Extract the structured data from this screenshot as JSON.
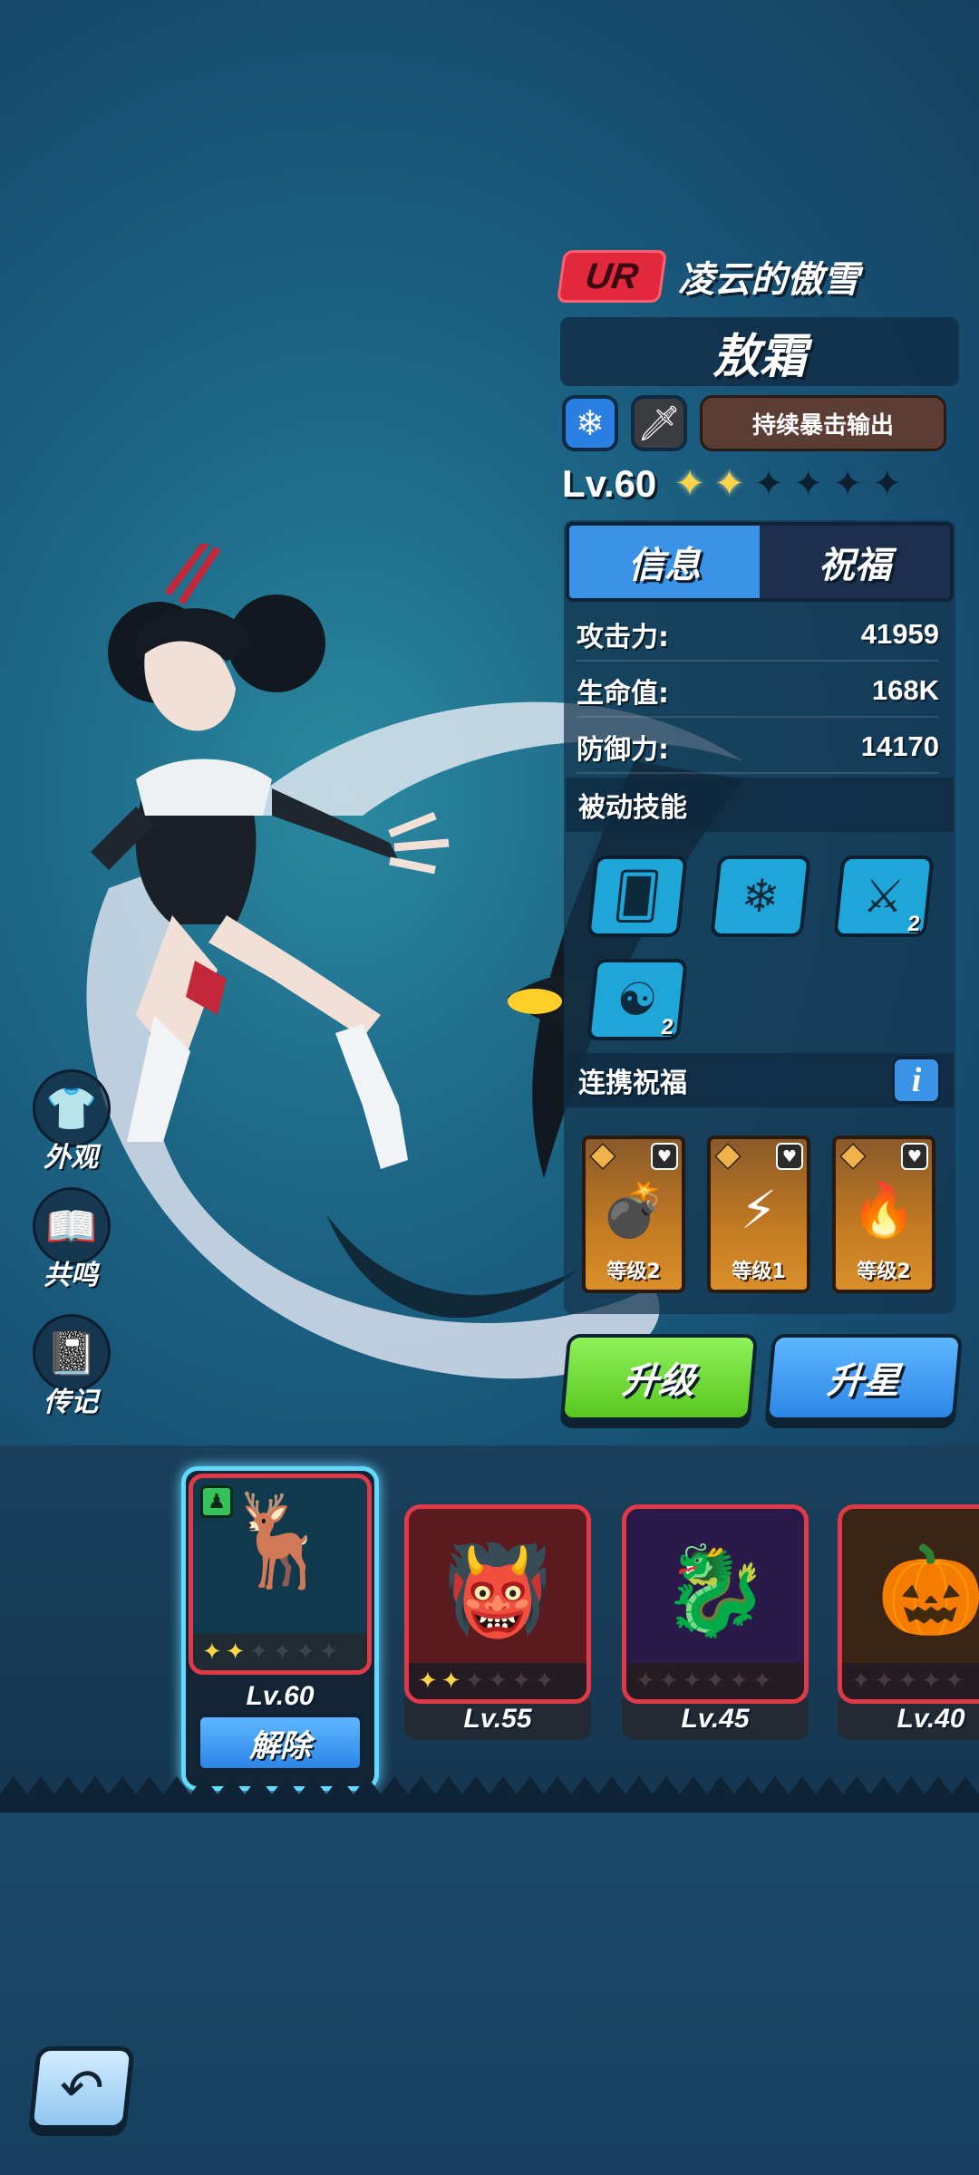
{
  "hero": {
    "rarity": "UR",
    "title": "凌云的傲雪",
    "name": "敖霜",
    "role": "持续暴击输出",
    "element_icon": "snowflake-icon",
    "weapon_icon": "sword-icon",
    "level": "Lv.60",
    "stars": {
      "filled": 2,
      "total": 6
    }
  },
  "tabs": [
    {
      "label": "信息",
      "active": true
    },
    {
      "label": "祝福",
      "active": false
    }
  ],
  "stats": [
    {
      "label": "攻击力:",
      "value": "41959"
    },
    {
      "label": "生命值:",
      "value": "168K"
    },
    {
      "label": "防御力:",
      "value": "14170"
    }
  ],
  "passive": {
    "title": "被动技能",
    "skills": [
      {
        "icon": "cards-icon",
        "count": ""
      },
      {
        "icon": "snowflakes-icon",
        "count": ""
      },
      {
        "icon": "claw-icon",
        "count": "2"
      },
      {
        "icon": "dragon-head-icon",
        "count": "2"
      }
    ]
  },
  "link_blessing": {
    "title": "连携祝福",
    "info": "i",
    "cards": [
      {
        "icon": "bomb-icon",
        "level": "等级2"
      },
      {
        "icon": "thunder-beast-icon",
        "level": "等级1"
      },
      {
        "icon": "fire-demon-icon",
        "level": "等级2"
      }
    ]
  },
  "actions": {
    "upgrade": "升级",
    "star_up": "升星"
  },
  "side_menu": [
    {
      "label": "外观",
      "icon": "shirt-icon"
    },
    {
      "label": "共鸣",
      "icon": "book-icon"
    },
    {
      "label": "传记",
      "icon": "journal-icon"
    }
  ],
  "hero_cards": [
    {
      "level": "Lv.60",
      "stars": 2,
      "selected": true,
      "action": "解除",
      "portrait": "deer-spirit-icon"
    },
    {
      "level": "Lv.55",
      "stars": 2,
      "selected": false,
      "portrait": "oni-mask-icon"
    },
    {
      "level": "Lv.45",
      "stars": 0,
      "selected": false,
      "portrait": "shadow-dragon-icon"
    },
    {
      "level": "Lv.40",
      "stars": 0,
      "selected": false,
      "portrait": "pumpkin-beast-icon"
    }
  ],
  "back_button": {
    "icon": "back-arrow-icon"
  },
  "colors": {
    "rarity": "#e2283c",
    "upgrade": "#6bd92f",
    "star_up": "#3a93e6",
    "active_tab": "#3a93e6",
    "selected_card": "#64d9ff"
  }
}
